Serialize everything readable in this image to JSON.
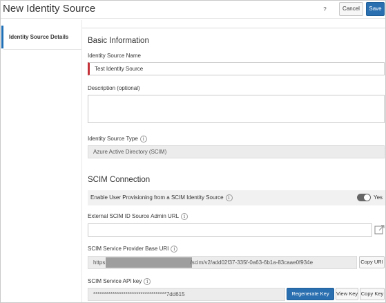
{
  "header": {
    "title": "New Identity Source",
    "help_label": "?",
    "cancel_label": "Cancel",
    "save_label": "Save"
  },
  "sidebar": {
    "items": [
      {
        "label": "Identity Source Details",
        "active": true
      }
    ]
  },
  "basic_info": {
    "heading": "Basic Information",
    "name_label": "Identity Source Name",
    "name_value": "Test Identity Source",
    "description_label": "Description (optional)",
    "description_value": "",
    "type_label": "Identity Source Type",
    "type_value": "Azure Active Directory (SCIM)"
  },
  "scim": {
    "heading": "SCIM Connection",
    "provisioning_label": "Enable User Provisioning from a SCIM Identity Source",
    "provisioning_enabled": true,
    "provisioning_state_label": "Yes",
    "admin_url_label": "External SCIM ID Source Admin URL",
    "admin_url_value": "",
    "base_uri_label": "SCIM Service Provider Base URI",
    "base_uri_prefix": "https:",
    "base_uri_suffix": "/scim/v2/add02f37-335f-0a63-6b1a-83caae0f934e",
    "copy_uri_label": "Copy URI",
    "api_key_label": "SCIM Service API key",
    "api_key_value": "**********************************7dd615",
    "regenerate_key_label": "Regenerate Key",
    "view_key_label": "View Key",
    "copy_key_label": "Copy Key"
  },
  "colors": {
    "accent": "#2a6fb0",
    "required_marker": "#c5323a",
    "sidebar_active_bar": "#1f6fb6"
  },
  "icons": {
    "info": "info-icon",
    "external_link": "external-link-icon",
    "help": "help-icon"
  }
}
